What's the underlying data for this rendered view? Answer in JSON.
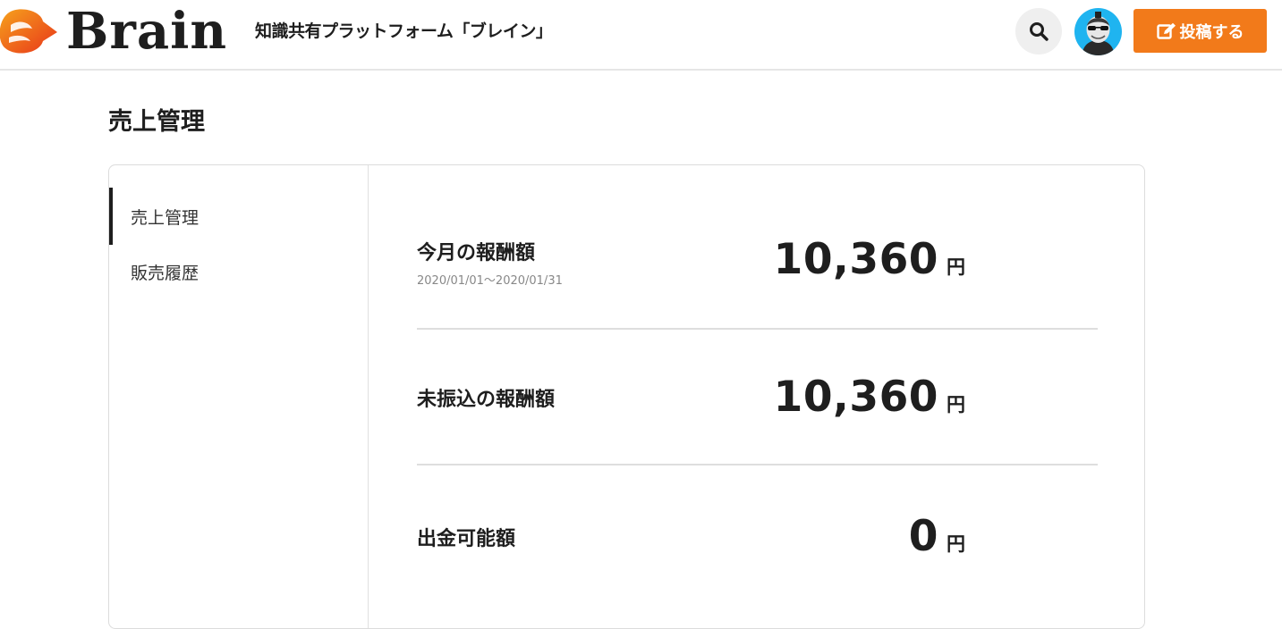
{
  "header": {
    "logo_text": "Brain",
    "tagline": "知識共有プラットフォーム「ブレイン」",
    "search_icon": "search-icon",
    "post_button_label": "投稿する",
    "post_icon": "edit-icon",
    "accent_color": "#f27a1a"
  },
  "page": {
    "title": "売上管理"
  },
  "sidebar": {
    "items": [
      {
        "label": "売上管理",
        "active": true
      },
      {
        "label": "販売履歴",
        "active": false
      }
    ]
  },
  "summary": {
    "rows": [
      {
        "label": "今月の報酬額",
        "period": "2020/01/01〜2020/01/31",
        "amount": "10,360",
        "unit": "円"
      },
      {
        "label": "未振込の報酬額",
        "amount": "10,360",
        "unit": "円"
      },
      {
        "label": "出金可能額",
        "amount": "0",
        "unit": "円"
      }
    ]
  }
}
